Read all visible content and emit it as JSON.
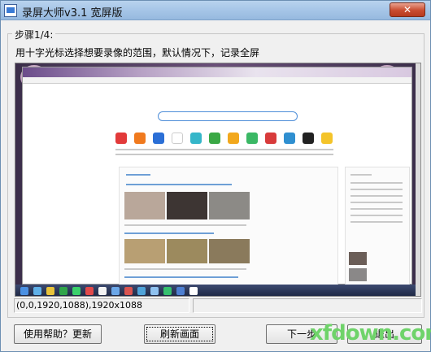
{
  "window": {
    "title": "录屏大师v3.1 宽屏版",
    "close_label": "✕"
  },
  "group": {
    "title": "步骤1/4:",
    "instruction": "用十字光标选择想要录像的范围，默认情况下，记录全屏"
  },
  "status": {
    "region": "(0,0,1920,1088),1920x1088",
    "right": ""
  },
  "buttons": {
    "help": "使用帮助？更新",
    "refresh": "刷新画面",
    "next": "下一步",
    "exit": "退出"
  },
  "watermark": "xfdown.com",
  "colors": {
    "titlebar": "#a6c5e7",
    "watermark": "#6fd36a"
  }
}
